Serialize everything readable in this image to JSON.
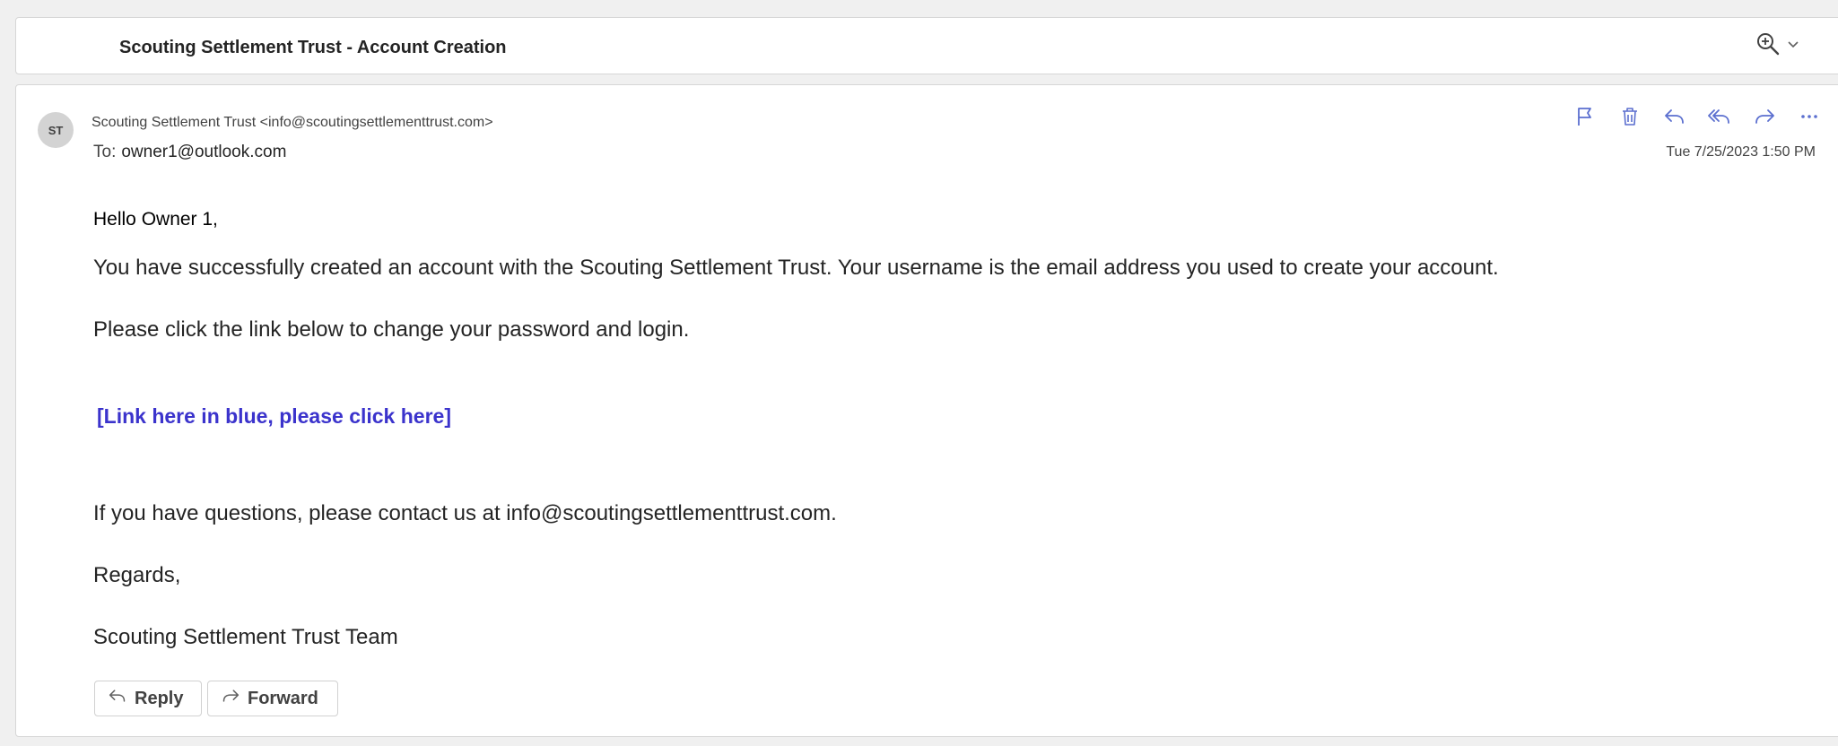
{
  "subject": {
    "title": "Scouting Settlement Trust - Account Creation"
  },
  "message": {
    "avatar_initials": "ST",
    "from": "Scouting Settlement Trust <info@scoutingsettlementtrust.com>",
    "to_label": "To:",
    "to_address": "owner1@outlook.com",
    "date": "Tue 7/25/2023 1:50 PM",
    "actions": [
      "flag-icon",
      "delete-icon",
      "reply-icon",
      "reply-all-icon",
      "forward-icon",
      "more-icon"
    ]
  },
  "body": {
    "greeting": "Hello Owner 1,",
    "paragraph1": "You have successfully created an account with the Scouting Settlement Trust. Your username is the email address you used to create your account.",
    "paragraph2": "Please click the link below to change your password and login.",
    "link_text": "[Link here in blue, please click here]",
    "paragraph3": "If you have questions, please contact us at info@scoutingsettlementtrust.com.",
    "regards": "Regards,",
    "signature": "Scouting Settlement Trust Team"
  },
  "footer_buttons": {
    "reply_label": "Reply",
    "forward_label": "Forward"
  },
  "colors": {
    "link": "#3b33cc",
    "icon": "#5b6fcf"
  }
}
